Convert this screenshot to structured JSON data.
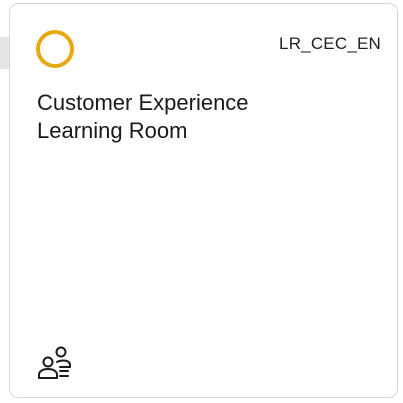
{
  "tile": {
    "code": "LR_CEC_EN",
    "title_line1": "Customer Experience",
    "title_line2": "Learning Room",
    "status_icon": "status-ring-icon",
    "footer_icon": "user-group-icon"
  },
  "colors": {
    "status_ring": "#e8a812",
    "border": "#d6d6d6",
    "text": "#1a1a1a"
  }
}
